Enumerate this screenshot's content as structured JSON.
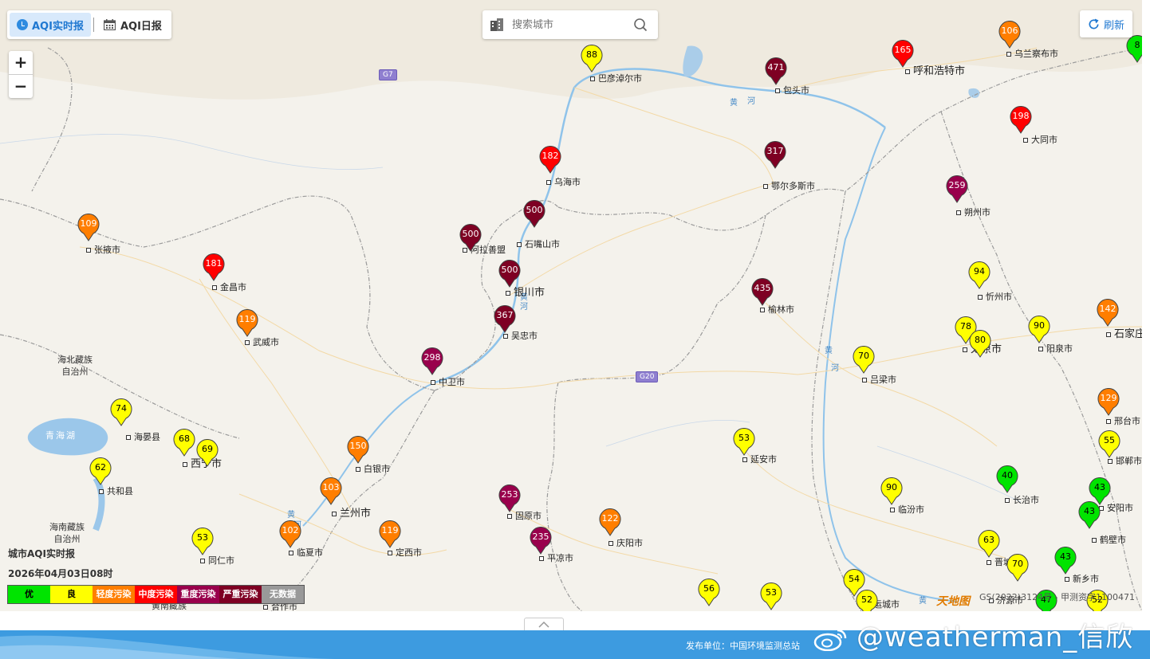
{
  "tabs": [
    {
      "label": "AQI实时报",
      "icon": "clock-icon",
      "active": true
    },
    {
      "label": "AQI日报",
      "icon": "calendar-icon",
      "active": false
    }
  ],
  "search": {
    "placeholder": "搜索城市"
  },
  "refresh_label": "刷新",
  "zoom": {
    "in": "+",
    "out": "−"
  },
  "legend": {
    "title": "城市AQI实时报",
    "time": "2026年04月03日08时",
    "items": [
      {
        "label": "优",
        "color": "#00e400",
        "text_color": "#000000"
      },
      {
        "label": "良",
        "color": "#ffff00",
        "text_color": "#000000"
      },
      {
        "label": "轻度污染",
        "color": "#ff7e00",
        "text_color": "#ffffff"
      },
      {
        "label": "中度污染",
        "color": "#ff0000",
        "text_color": "#ffffff"
      },
      {
        "label": "重度污染",
        "color": "#99004c",
        "text_color": "#ffffff"
      },
      {
        "label": "严重污染",
        "color": "#7e0023",
        "text_color": "#ffffff"
      },
      {
        "label": "无数据",
        "color": "#999999",
        "text_color": "#ffffff"
      }
    ]
  },
  "roads": [
    "G7",
    "G20"
  ],
  "rivers": [
    "黄",
    "河",
    "黄",
    "河",
    "黄",
    "河",
    "黄",
    "河",
    "黄"
  ],
  "lake": "青海湖",
  "regions": [
    {
      "lines": [
        "海北藏族",
        "自治州"
      ]
    },
    {
      "lines": [
        "海南藏族",
        "自治州"
      ]
    },
    {
      "lines": [
        "黄南藏族"
      ]
    }
  ],
  "cities": [
    {
      "name": "巴彦淖尔市",
      "aqi": "88"
    },
    {
      "name": "包头市",
      "aqi": "471"
    },
    {
      "name": "呼和浩特市",
      "aqi": "165"
    },
    {
      "name": "乌兰察布市",
      "aqi": "106"
    },
    {
      "name": "大同市",
      "aqi": "198"
    },
    {
      "name": "乌海市",
      "aqi": "182"
    },
    {
      "name": "鄂尔多斯市",
      "aqi": "317"
    },
    {
      "name": "朔州市",
      "aqi": "259"
    },
    {
      "name": "石嘴山市",
      "aqi": "500"
    },
    {
      "name": "阿拉善盟",
      "aqi": "500"
    },
    {
      "name": "银川市",
      "aqi": "500"
    },
    {
      "name": "张掖市",
      "aqi": "109"
    },
    {
      "name": "金昌市",
      "aqi": "181"
    },
    {
      "name": "榆林市",
      "aqi": "435"
    },
    {
      "name": "忻州市",
      "aqi": "94"
    },
    {
      "name": "石家庄",
      "aqi": "142"
    },
    {
      "name": "吴忠市",
      "aqi": "367"
    },
    {
      "name": "武威市",
      "aqi": "119"
    },
    {
      "name": "太原市",
      "aqi": "78"
    },
    {
      "name": "晋中市",
      "aqi": "80"
    },
    {
      "name": "阳泉市",
      "aqi": "90"
    },
    {
      "name": "中卫市",
      "aqi": "298"
    },
    {
      "name": "吕梁市",
      "aqi": "70"
    },
    {
      "name": "海晏县",
      "aqi": "74"
    },
    {
      "name": "邢台市",
      "aqi": "129"
    },
    {
      "name": "西宁市",
      "aqi": "68"
    },
    {
      "name": "西宁市",
      "aqi": "69"
    },
    {
      "name": "白银市",
      "aqi": "150"
    },
    {
      "name": "延安市",
      "aqi": "53"
    },
    {
      "name": "邯郸市",
      "aqi": "55"
    },
    {
      "name": "共和县",
      "aqi": "62"
    },
    {
      "name": "兰州市",
      "aqi": "103"
    },
    {
      "name": "固原市",
      "aqi": "253"
    },
    {
      "name": "临汾市",
      "aqi": "90"
    },
    {
      "name": "长治市",
      "aqi": "40"
    },
    {
      "name": "安阳市",
      "aqi": "43"
    },
    {
      "name": "鹤壁市",
      "aqi": "43"
    },
    {
      "name": "临夏市",
      "aqi": "102"
    },
    {
      "name": "定西市",
      "aqi": "119"
    },
    {
      "name": "庆阳市",
      "aqi": "122"
    },
    {
      "name": "平凉市",
      "aqi": "235"
    },
    {
      "name": "同仁市",
      "aqi": "53"
    },
    {
      "name": "晋城市",
      "aqi": "63"
    },
    {
      "name": "新乡市",
      "aqi": "43"
    },
    {
      "name": "济源市",
      "aqi": "70"
    },
    {
      "name": "合作市",
      "aqi": ""
    },
    {
      "name": "",
      "aqi": "56"
    },
    {
      "name": "",
      "aqi": "53"
    },
    {
      "name": "运城市",
      "aqi": "54"
    },
    {
      "name": "",
      "aqi": "52"
    },
    {
      "name": "",
      "aqi": "47"
    },
    {
      "name": "",
      "aqi": "52"
    },
    {
      "name": "",
      "aqi": "8"
    }
  ],
  "copyright": "GS(2022)3124号 - 甲测资字1100471",
  "map_logo": "天地图",
  "footer": {
    "publisher": "发布单位：中国环境监测总站"
  },
  "watermark": "@weatherman_信欣"
}
